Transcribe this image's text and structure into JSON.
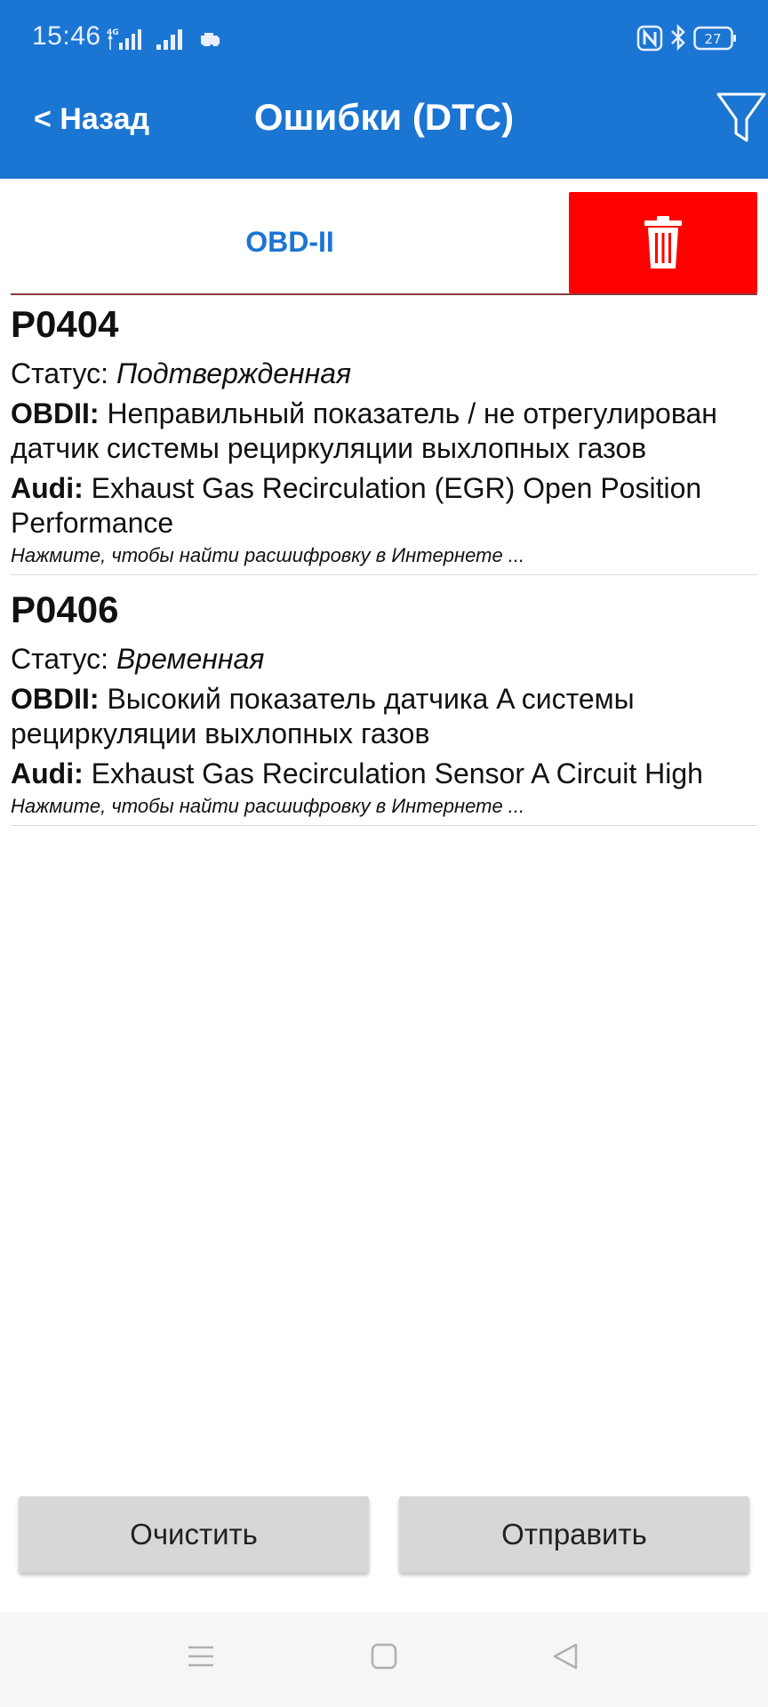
{
  "status_bar": {
    "time": "15:46",
    "network": "4G",
    "battery": "27",
    "icons": [
      "signal-4g-icon",
      "signal-icon",
      "car-engine-icon",
      "nfc-icon",
      "bluetooth-icon",
      "battery-icon"
    ]
  },
  "app_bar": {
    "back_label": "< Назад",
    "title": "Ошибки (DTC)",
    "filter_icon": "filter-icon"
  },
  "tabs": {
    "obd_label": "OBD-II",
    "delete_icon": "trash-icon",
    "delete_color": "#ff0000"
  },
  "dtc_codes": [
    {
      "code": "P0404",
      "status_label": "Статус: ",
      "status_value": "Подтвержденная",
      "obd_label": "OBDII:",
      "obd_text": " Неправильный показатель / не отрегулирован датчик системы рециркуляции выхлопных газов",
      "brand_label": "Audi:",
      "brand_text": " Exhaust Gas Recirculation (EGR) Open Position Performance",
      "link_text": "Нажмите, чтобы найти расшифровку в Интернете ..."
    },
    {
      "code": "P0406",
      "status_label": "Статус: ",
      "status_value": "Временная",
      "obd_label": "OBDII:",
      "obd_text": " Высокий показатель датчика A системы рециркуляции выхлопных газов",
      "brand_label": "Audi:",
      "brand_text": " Exhaust Gas Recirculation Sensor A Circuit High",
      "link_text": "Нажмите, чтобы найти расшифровку в Интернете ..."
    }
  ],
  "bottom_buttons": {
    "clear_label": "Очистить",
    "send_label": "Отправить"
  },
  "nav_bar": {
    "icons": [
      "menu-icon",
      "home-icon",
      "back-icon"
    ]
  },
  "colors": {
    "accent": "#1b75d3",
    "delete": "#ff0000",
    "button_bg": "#d7d7d7"
  }
}
